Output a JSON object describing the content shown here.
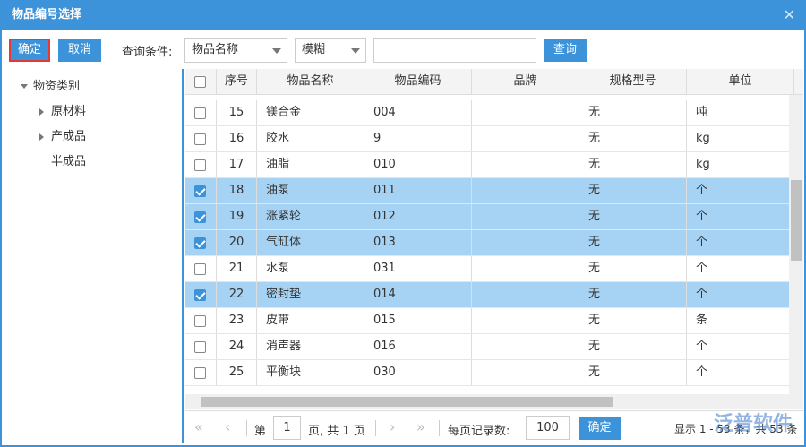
{
  "title": "物品编号选择",
  "toolbar": {
    "confirm": "确定",
    "cancel": "取消",
    "query_label": "查询条件:",
    "field_select": "物品名称",
    "match_select": "模糊",
    "search_value": "",
    "search_button": "查询"
  },
  "tree": {
    "root": "物资类别",
    "children": [
      "原材料",
      "产成品",
      "半成品"
    ]
  },
  "columns": [
    "序号",
    "物品名称",
    "物品编码",
    "品牌",
    "规格型号",
    "单位"
  ],
  "rows": [
    {
      "no": "15",
      "name": "镁合金",
      "code": "004",
      "brand": "",
      "spec": "无",
      "unit": "吨",
      "checked": false
    },
    {
      "no": "16",
      "name": "胶水",
      "code": "9",
      "brand": "",
      "spec": "无",
      "unit": "kg",
      "checked": false
    },
    {
      "no": "17",
      "name": "油脂",
      "code": "010",
      "brand": "",
      "spec": "无",
      "unit": "kg",
      "checked": false
    },
    {
      "no": "18",
      "name": "油泵",
      "code": "011",
      "brand": "",
      "spec": "无",
      "unit": "个",
      "checked": true
    },
    {
      "no": "19",
      "name": "涨紧轮",
      "code": "012",
      "brand": "",
      "spec": "无",
      "unit": "个",
      "checked": true
    },
    {
      "no": "20",
      "name": "气缸体",
      "code": "013",
      "brand": "",
      "spec": "无",
      "unit": "个",
      "checked": true
    },
    {
      "no": "21",
      "name": "水泵",
      "code": "031",
      "brand": "",
      "spec": "无",
      "unit": "个",
      "checked": false
    },
    {
      "no": "22",
      "name": "密封垫",
      "code": "014",
      "brand": "",
      "spec": "无",
      "unit": "个",
      "checked": true
    },
    {
      "no": "23",
      "name": "皮带",
      "code": "015",
      "brand": "",
      "spec": "无",
      "unit": "条",
      "checked": false
    },
    {
      "no": "24",
      "name": "消声器",
      "code": "016",
      "brand": "",
      "spec": "无",
      "unit": "个",
      "checked": false
    },
    {
      "no": "25",
      "name": "平衡块",
      "code": "030",
      "brand": "",
      "spec": "无",
      "unit": "个",
      "checked": false
    }
  ],
  "pager": {
    "page_prefix": "第",
    "page": "1",
    "page_suffix": "页, 共 1 页",
    "page_size_label": "每页记录数:",
    "page_size": "100",
    "confirm": "确定",
    "summary": "显示 1 - 53 条，共 53 条"
  },
  "watermark": "泛普软件",
  "colors": {
    "accent": "#3c93d9",
    "selected_row": "#a6d2f3"
  }
}
